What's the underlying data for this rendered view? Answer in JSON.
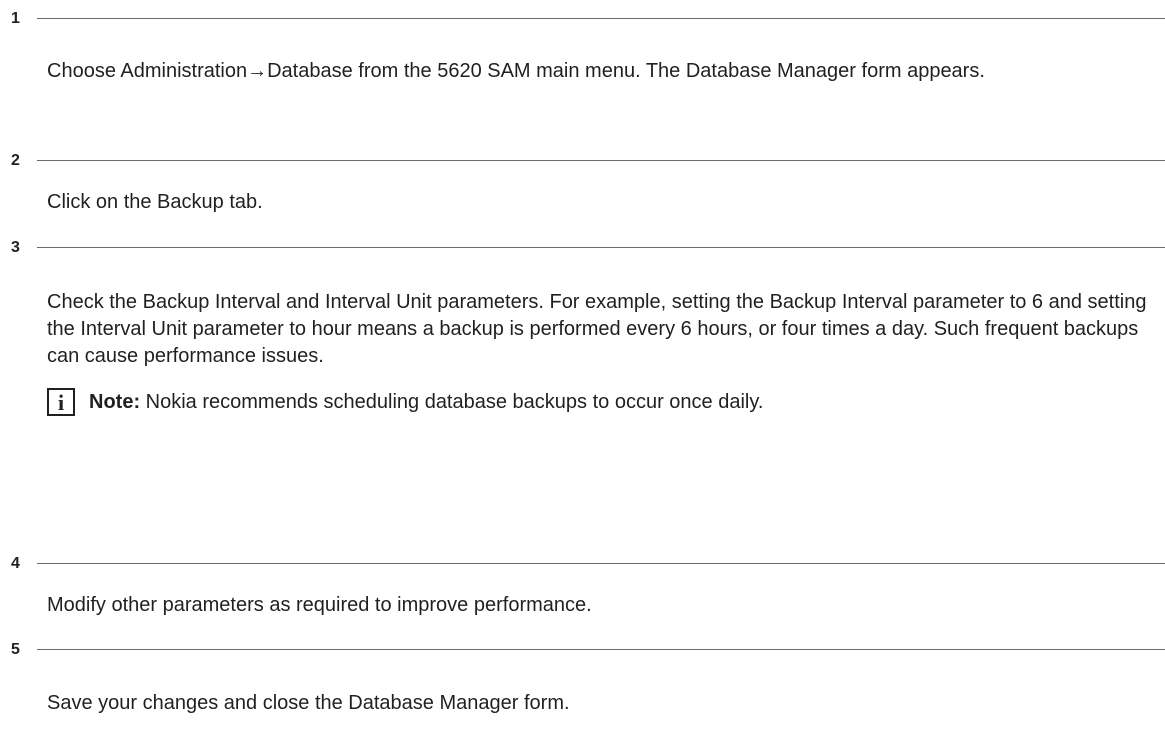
{
  "steps": [
    {
      "number": "1",
      "text": "Choose Administration→Database from the 5620 SAM main menu. The Database Manager form appears."
    },
    {
      "number": "2",
      "text": "Click on the Backup tab."
    },
    {
      "number": "3",
      "text": "Check the Backup Interval and Interval Unit parameters. For example, setting the Backup Interval parameter to 6 and setting the Interval Unit parameter to hour means a backup is performed every 6 hours, or four times a day. Such frequent backups can cause performance issues.",
      "note": {
        "icon": "info-icon",
        "icon_glyph": "i",
        "label": "Note:",
        "text": " Nokia recommends scheduling database backups to occur once daily."
      }
    },
    {
      "number": "4",
      "text": "Modify other parameters as required to improve performance."
    },
    {
      "number": "5",
      "text": "Save your changes and close the Database Manager form."
    }
  ]
}
